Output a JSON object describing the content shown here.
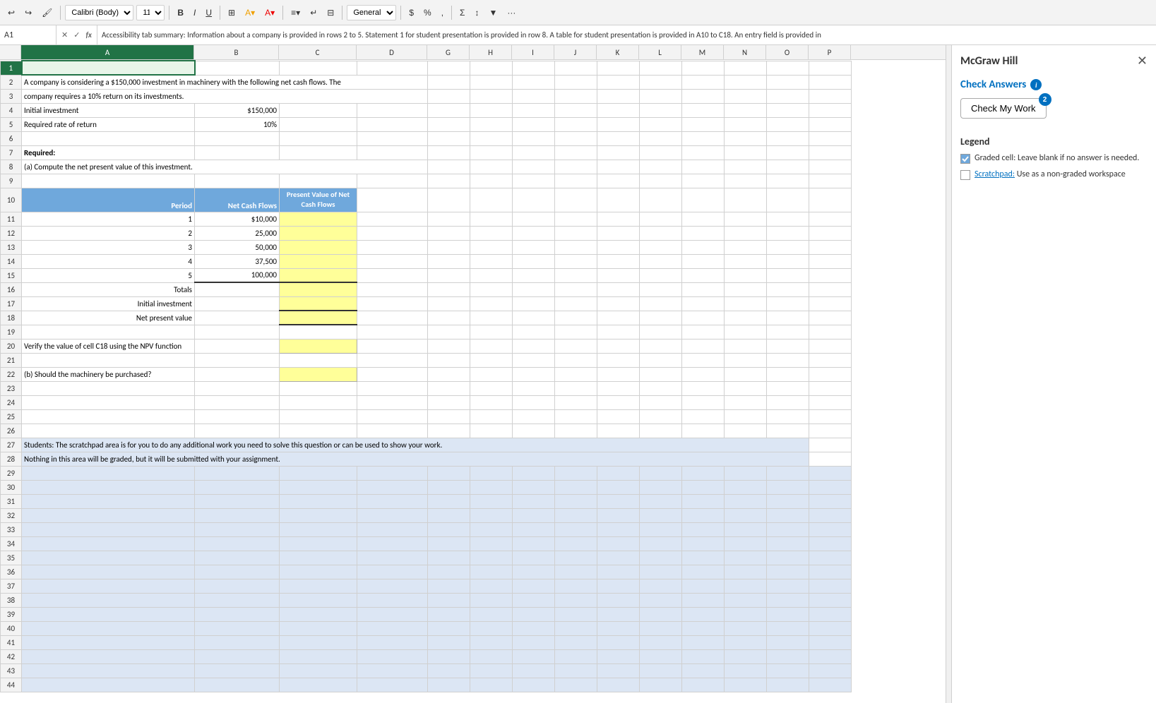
{
  "toolbar": {
    "font_name": "Calibri (Body)",
    "font_size": "11",
    "format": "General",
    "dollar_label": "$",
    "sum_label": "Σ"
  },
  "formula_bar": {
    "cell_ref": "A1",
    "formula_text": "Accessibility tab summary: Information about a company is provided in rows 2 to 5. Statement 1 for student presentation is provided in row 8. A table for student presentation is provided in A10 to C18. An entry field is provided in"
  },
  "columns": [
    "A",
    "B",
    "C",
    "D",
    "G",
    "H",
    "I",
    "J",
    "K",
    "L",
    "M",
    "N",
    "O",
    "P"
  ],
  "rows": {
    "1": {
      "a": "",
      "b": "",
      "c": "",
      "d": ""
    },
    "2": {
      "a": "A company is considering a $150,000 investment in machinery with the following net cash flows. The",
      "b": "",
      "c": "",
      "d": ""
    },
    "3": {
      "a": "company requires a 10% return on its investments.",
      "b": "",
      "c": "",
      "d": ""
    },
    "4": {
      "a": "Initial investment",
      "b": "$150,000",
      "c": "",
      "d": ""
    },
    "5": {
      "a": "Required rate of return",
      "b": "10%",
      "c": "",
      "d": ""
    },
    "7": {
      "a": "Required:",
      "b": "",
      "c": "",
      "d": ""
    },
    "8": {
      "a": "(a) Compute the net present value of this investment.",
      "b": "",
      "c": "",
      "d": ""
    },
    "10_header_a": "Period",
    "10_header_b": "Net Cash Flows",
    "10_header_c_line1": "Present Value of Net",
    "10_header_c_line2": "Cash Flows",
    "11": {
      "a": "1",
      "b": "$10,000",
      "c": ""
    },
    "12": {
      "a": "2",
      "b": "25,000",
      "c": ""
    },
    "13": {
      "a": "3",
      "b": "50,000",
      "c": ""
    },
    "14": {
      "a": "4",
      "b": "37,500",
      "c": ""
    },
    "15": {
      "a": "5",
      "b": "100,000",
      "c": ""
    },
    "16": {
      "a": "Totals",
      "b": "",
      "c": ""
    },
    "17": {
      "a": "Initial investment",
      "b": "",
      "c": ""
    },
    "18": {
      "a": "Net present value",
      "b": "",
      "c": ""
    },
    "20": {
      "a": "Verify the value of cell C18 using the NPV function",
      "c": ""
    },
    "22": {
      "a": "(b) Should the machinery be purchased?",
      "c": ""
    },
    "27": {
      "a": "Students: The scratchpad area is for you to do any additional work you need to solve this question or can be used to show your work."
    },
    "28": {
      "a": "Nothing in this area will be graded, but it will be submitted with your assignment."
    }
  },
  "panel": {
    "title": "McGraw Hill",
    "close_label": "✕",
    "check_answers_title": "Check Answers",
    "check_my_work_label": "Check My Work",
    "badge_count": "2",
    "legend_title": "Legend",
    "graded_label": "Graded cell: Leave blank if no answer is needed.",
    "scratchpad_label": "Scratchpad:",
    "scratchpad_desc": "Use as a non-graded workspace"
  }
}
